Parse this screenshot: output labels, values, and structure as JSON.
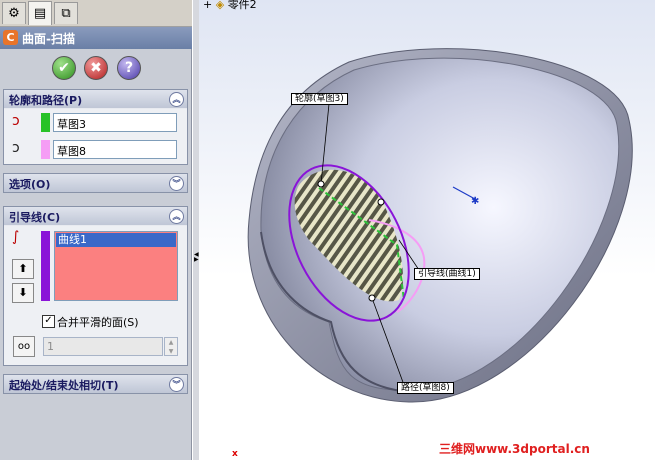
{
  "panel": {
    "title": "曲面-扫描",
    "tabs": [
      "feature-manager-icon",
      "property-manager-icon",
      "configuration-manager-icon"
    ],
    "buttons": {
      "ok": "✔",
      "cancel": "✖",
      "help": "?"
    },
    "profile_path": {
      "heading": "轮廓和路径(P)",
      "profile": "草图3",
      "path": "草图8",
      "profile_color": "#27c227",
      "path_color": "#f59df5"
    },
    "options": {
      "heading": "选项(O)"
    },
    "guides": {
      "heading": "引导线(C)",
      "items": [
        "曲线1"
      ],
      "swatch_color": "#8a14d8",
      "merge_label": "合并平滑的面(S)",
      "merge_checked": true,
      "count_value": "1"
    },
    "tangency": {
      "heading": "起始处/结束处相切(T)"
    }
  },
  "viewport": {
    "tree_label": "零件2",
    "callouts": {
      "profile": "轮廓(草图3)",
      "guide": "引导线(曲线1)",
      "path": "路径(草图8)"
    },
    "watermark": "三维网www.3dportal.cn"
  }
}
